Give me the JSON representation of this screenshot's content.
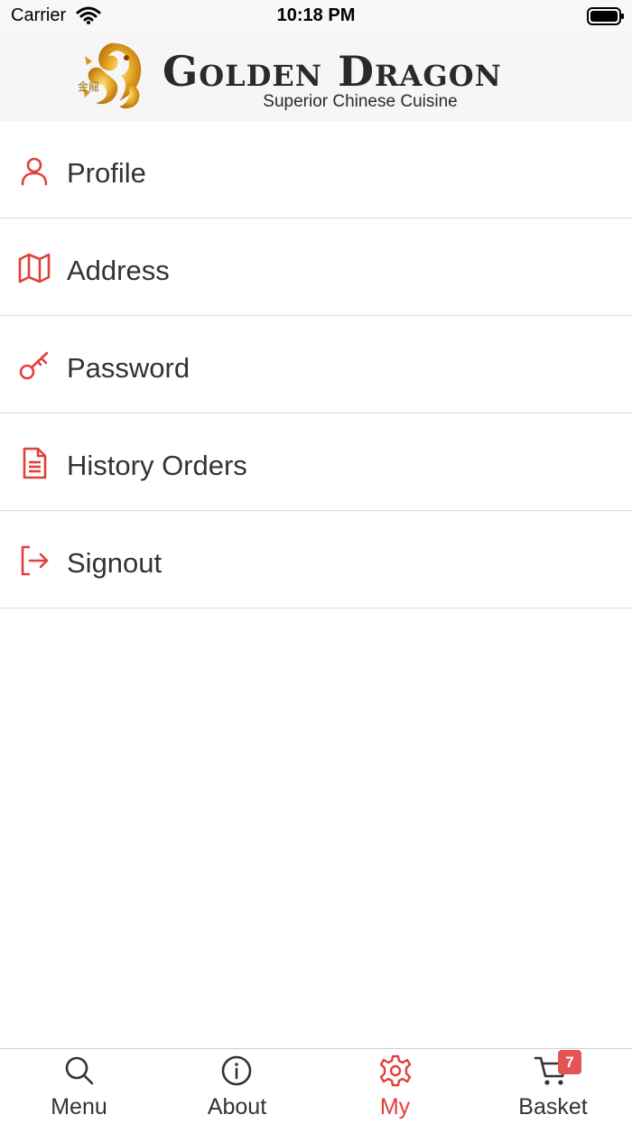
{
  "status_bar": {
    "carrier": "Carrier",
    "time": "10:18 PM"
  },
  "header": {
    "logo_text": "金龍",
    "title": "Golden Dragon",
    "subtitle": "Superior Chinese Cuisine"
  },
  "accent_color": "#e0403a",
  "menu": {
    "items": [
      {
        "label": "Profile",
        "icon": "person-icon"
      },
      {
        "label": "Address",
        "icon": "map-icon"
      },
      {
        "label": "Password",
        "icon": "key-icon"
      },
      {
        "label": "History Orders",
        "icon": "document-icon"
      },
      {
        "label": "Signout",
        "icon": "signout-icon"
      }
    ]
  },
  "tab_bar": {
    "tabs": [
      {
        "label": "Menu",
        "icon": "search-icon"
      },
      {
        "label": "About",
        "icon": "info-icon"
      },
      {
        "label": "My",
        "icon": "gear-icon",
        "active": true
      },
      {
        "label": "Basket",
        "icon": "cart-icon"
      }
    ],
    "basket_count": "7"
  }
}
